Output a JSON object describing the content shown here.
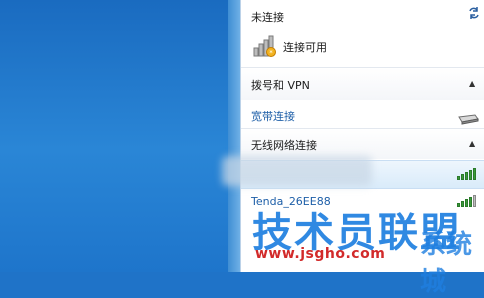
{
  "panel": {
    "not_connected": "未连接",
    "connections_available": "连接可用",
    "dialup_vpn_header": "拨号和 VPN",
    "broadband_label": "宽带连接",
    "wireless_header": "无线网络连接",
    "networks": [
      {
        "ssid": "",
        "signal_bars": 5
      },
      {
        "ssid": "Tenda_26EE88",
        "signal_bars": 5
      }
    ]
  },
  "watermark": {
    "text": "技术员联盟",
    "url": "www.jsgho.com",
    "side": "系统城"
  },
  "colors": {
    "accent": "#1e5fa8",
    "signal": "#3a9a3a",
    "desktop": "#1f73c8"
  }
}
